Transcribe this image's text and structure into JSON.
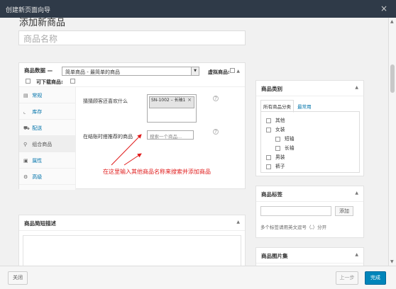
{
  "window": {
    "title": "创建新页面向导",
    "close_glyph": "×"
  },
  "page": {
    "heading": "添加新商品",
    "title_placeholder": "商品名称"
  },
  "product_data": {
    "label": "商品数据 —",
    "type_select": "简单商品 - 最简单的商品",
    "virtual_label": "虚拟商品:",
    "downloadable_label": "可下载商品:",
    "tabs": [
      {
        "icon": "general-icon",
        "glyph": "▤",
        "label": "常规"
      },
      {
        "icon": "inventory-icon",
        "glyph": "⌞",
        "label": "库存"
      },
      {
        "icon": "shipping-icon",
        "glyph": "⛟",
        "label": "配送"
      },
      {
        "icon": "linked-products-icon",
        "glyph": "⚲",
        "label": "组合商品"
      },
      {
        "icon": "attributes-icon",
        "glyph": "▣",
        "label": "属性"
      },
      {
        "icon": "advanced-icon",
        "glyph": "⚙",
        "label": "高级"
      }
    ],
    "upsells_label": "猜猜顾客还喜欢什么",
    "upsells_tag": "SN-1002 – 长袖1",
    "crosssells_label": "在结账时搭推荐的商品",
    "crosssells_placeholder": "搜索一个商品..."
  },
  "annotation": "在这里输入其他商品名称来搜索并添加商品",
  "short_desc": {
    "title": "商品简短描述"
  },
  "categories": {
    "title": "商品类别",
    "tab_all": "所有商品分类",
    "tab_popular": "最常用",
    "items": [
      "其他",
      "女装",
      "短袖",
      "长袖",
      "男装",
      "裤子"
    ]
  },
  "tags": {
    "title": "商品标签",
    "add_label": "添加",
    "hint": "多个标签请用英文逗号（,）分开"
  },
  "gallery": {
    "title": "商品图片集"
  },
  "footer": {
    "close": "关闭",
    "prev": "上一步",
    "done": "完成"
  },
  "colors": {
    "titlebar": "#2f3a48",
    "link": "#0073aa",
    "primary": "#0085ba",
    "annotation": "#e01c1c"
  }
}
